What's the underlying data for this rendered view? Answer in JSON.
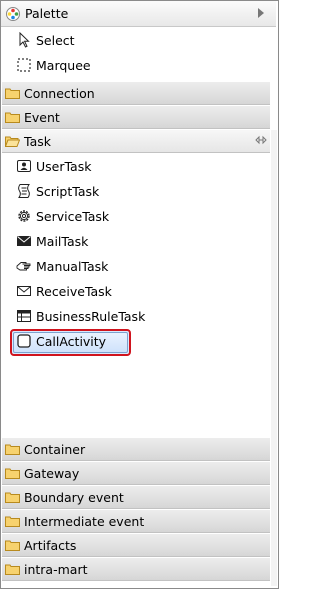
{
  "palette": {
    "title": "Palette",
    "tools": [
      {
        "label": "Select",
        "icon": "arrow-pointer-icon"
      },
      {
        "label": "Marquee",
        "icon": "marquee-icon"
      }
    ]
  },
  "drawers_top": [
    {
      "label": "Connection",
      "icon": "folder-icon"
    },
    {
      "label": "Event",
      "icon": "folder-icon"
    }
  ],
  "task_drawer": {
    "label": "Task",
    "icon": "folder-open-icon",
    "items": [
      {
        "label": "UserTask",
        "icon": "user-task-icon"
      },
      {
        "label": "ScriptTask",
        "icon": "script-task-icon"
      },
      {
        "label": "ServiceTask",
        "icon": "gear-icon"
      },
      {
        "label": "MailTask",
        "icon": "envelope-dark-icon"
      },
      {
        "label": "ManualTask",
        "icon": "hand-icon"
      },
      {
        "label": "ReceiveTask",
        "icon": "envelope-icon"
      },
      {
        "label": "BusinessRuleTask",
        "icon": "table-icon"
      },
      {
        "label": "CallActivity",
        "icon": "rounded-rect-icon",
        "selected": true
      }
    ]
  },
  "drawers_bottom": [
    {
      "label": "Container"
    },
    {
      "label": "Gateway"
    },
    {
      "label": "Boundary event"
    },
    {
      "label": "Intermediate event"
    },
    {
      "label": "Artifacts"
    },
    {
      "label": "intra-mart"
    }
  ],
  "colors": {
    "highlight_border": "#d0141e",
    "selected_fill": "#d9e9ff",
    "folder": "#f2c14e"
  }
}
